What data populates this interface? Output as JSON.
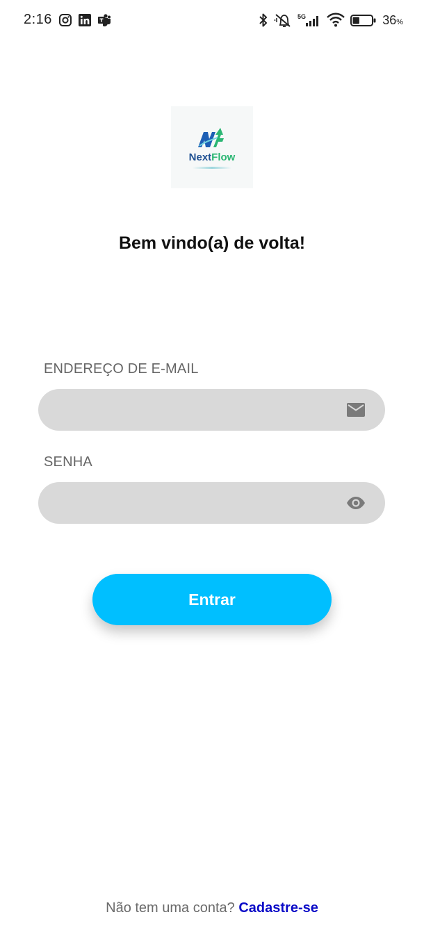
{
  "status_bar": {
    "time": "2:16",
    "left_icons": [
      "instagram-icon",
      "linkedin-icon",
      "teams-icon"
    ],
    "right_icons": [
      "bluetooth-icon",
      "vibrate-off-icon",
      "5g-signal-icon",
      "wifi-icon",
      "battery-icon"
    ],
    "network_label": "5G",
    "battery_percent": "36",
    "battery_unit": "%",
    "battery_level": 0.36
  },
  "logo": {
    "name_part1": "Next",
    "name_part2": "Flow",
    "mark": "NF",
    "colors": {
      "blue": "#1d4f91",
      "green": "#2bb673"
    }
  },
  "welcome": {
    "title": "Bem vindo(a) de volta!"
  },
  "form": {
    "email": {
      "label": "ENDEREÇO DE E-MAIL",
      "value": "",
      "placeholder": "",
      "icon": "mail-icon"
    },
    "password": {
      "label": "SENHA",
      "value": "",
      "placeholder": "",
      "icon": "eye-icon"
    },
    "submit_label": "Entrar"
  },
  "footer": {
    "question": "Não tem uma conta?",
    "link": "Cadastre-se"
  },
  "colors": {
    "accent": "#00bfff",
    "field_bg": "#d9d9d9",
    "link": "#0b0bc7",
    "label": "#666666"
  }
}
